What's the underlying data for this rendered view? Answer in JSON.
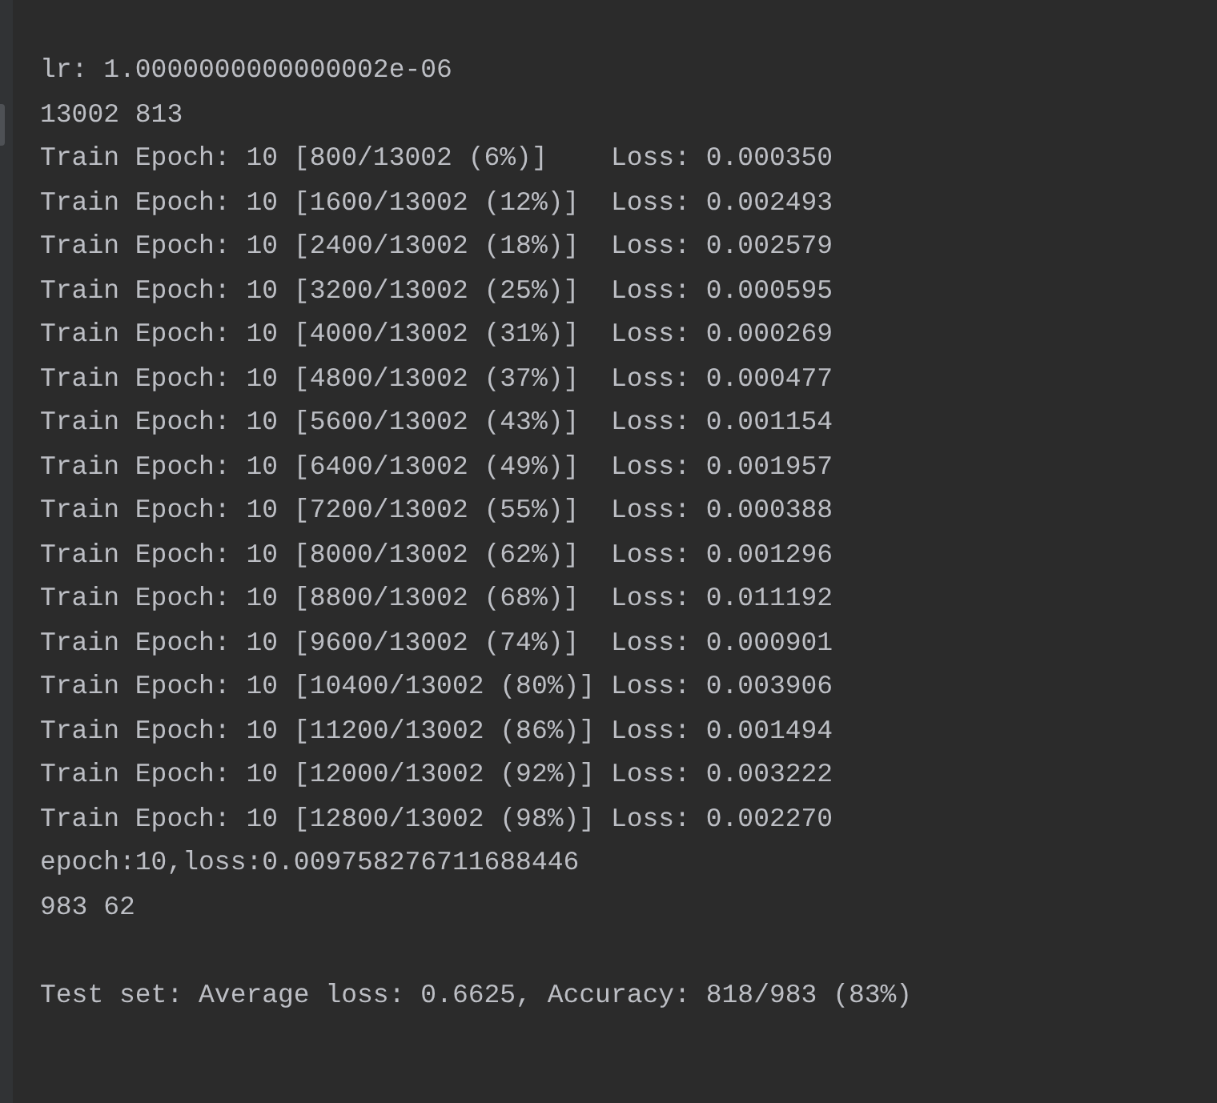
{
  "console": {
    "blocks": [
      [
        "lr: 1.0000000000000002e-06",
        "13002 813",
        "Train Epoch: 10 [800/13002 (6%)]    Loss: 0.000350",
        "Train Epoch: 10 [1600/13002 (12%)]  Loss: 0.002493",
        "Train Epoch: 10 [2400/13002 (18%)]  Loss: 0.002579",
        "Train Epoch: 10 [3200/13002 (25%)]  Loss: 0.000595",
        "Train Epoch: 10 [4000/13002 (31%)]  Loss: 0.000269",
        "Train Epoch: 10 [4800/13002 (37%)]  Loss: 0.000477",
        "Train Epoch: 10 [5600/13002 (43%)]  Loss: 0.001154",
        "Train Epoch: 10 [6400/13002 (49%)]  Loss: 0.001957",
        "Train Epoch: 10 [7200/13002 (55%)]  Loss: 0.000388",
        "Train Epoch: 10 [8000/13002 (62%)]  Loss: 0.001296",
        "Train Epoch: 10 [8800/13002 (68%)]  Loss: 0.011192",
        "Train Epoch: 10 [9600/13002 (74%)]  Loss: 0.000901",
        "Train Epoch: 10 [10400/13002 (80%)] Loss: 0.003906",
        "Train Epoch: 10 [11200/13002 (86%)] Loss: 0.001494",
        "Train Epoch: 10 [12000/13002 (92%)] Loss: 0.003222",
        "Train Epoch: 10 [12800/13002 (98%)] Loss: 0.002270",
        "epoch:10,loss:0.009758276711688446",
        "983 62"
      ],
      [
        "Test set: Average loss: 0.6625, Accuracy: 818/983 (83%)"
      ]
    ]
  }
}
